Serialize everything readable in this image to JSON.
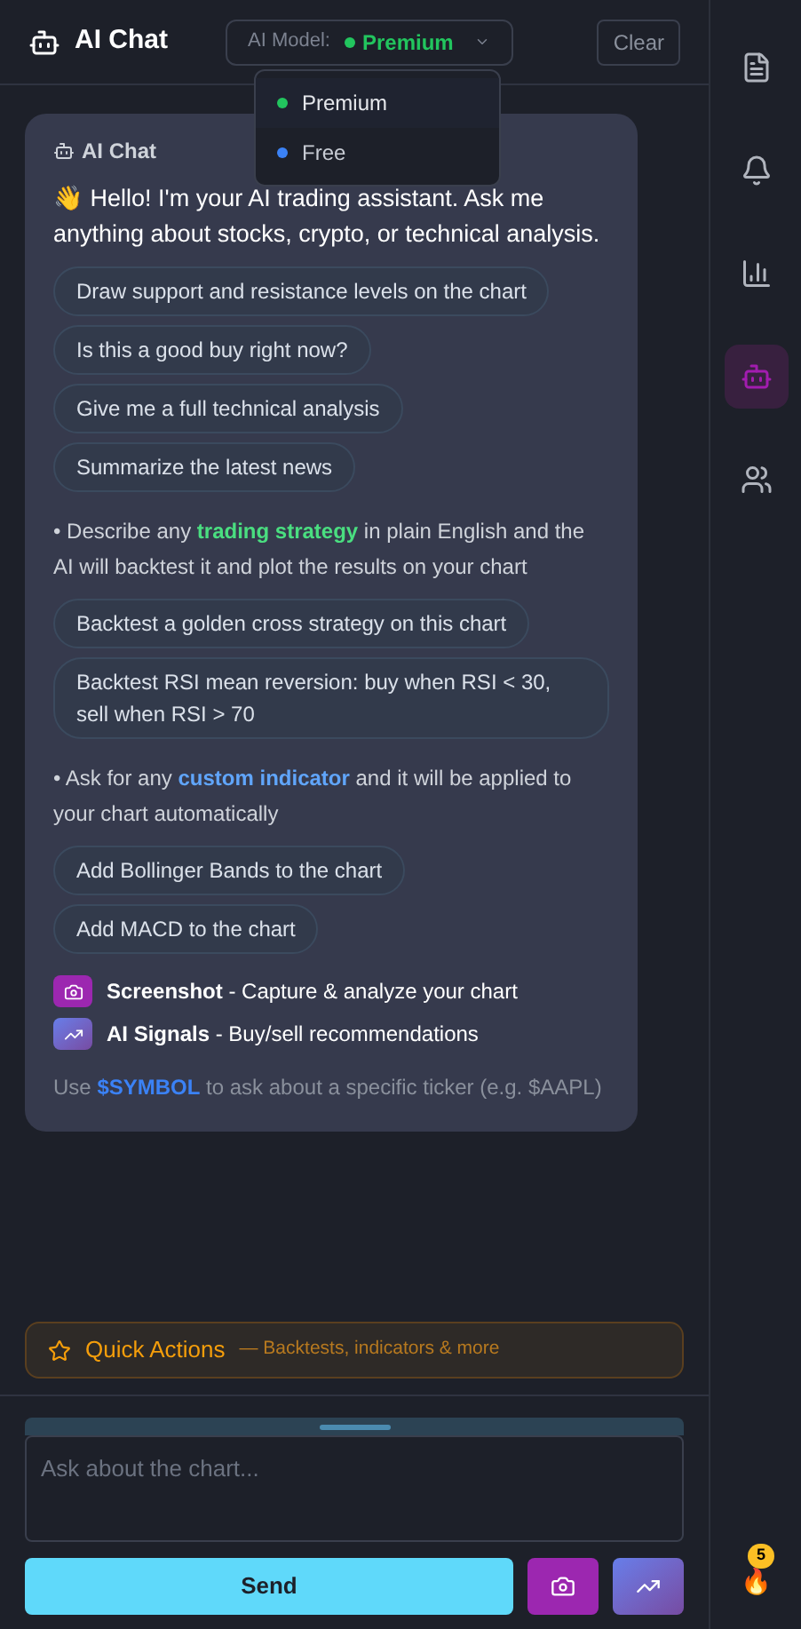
{
  "header": {
    "title": "AI Chat",
    "model": {
      "label": "AI Model:",
      "value": "Premium",
      "color": "#22c55e",
      "expanded": true,
      "options": [
        {
          "label": "Premium",
          "color": "#22c55e",
          "selected": true
        },
        {
          "label": "Free",
          "color": "#3b82f6",
          "selected": false
        }
      ]
    },
    "clear": "Clear"
  },
  "message": {
    "sender": "AI Chat",
    "greeting": "👋 Hello! I'm your AI trading assistant. Ask me anything about stocks, crypto, or technical analysis.",
    "suggestions": [
      "Draw support and resistance levels on the chart",
      "Is this a good buy right now?",
      "Give me a full technical analysis",
      "Summarize the latest news"
    ],
    "sections": [
      {
        "before": "• Describe any ",
        "highlight": "trading strategy",
        "after": " in plain English and the AI will backtest it and plot the results on your chart",
        "color": "#4ade80",
        "suggestions": [
          "Backtest a golden cross strategy on this chart",
          "Backtest RSI mean reversion: buy when RSI < 30, sell when RSI > 70"
        ]
      },
      {
        "before": "• Ask for any ",
        "highlight": "custom indicator",
        "after": " and it will be applied to your chart automatically",
        "color": "#60a5fa",
        "suggestions": [
          "Add Bollinger Bands to the chart",
          "Add MACD to the chart"
        ]
      }
    ],
    "features": [
      {
        "kind": "screenshot",
        "title": "Screenshot",
        "description": " - Capture & analyze your chart"
      },
      {
        "kind": "signals",
        "title": "AI Signals",
        "description": " - Buy/sell recommendations"
      }
    ],
    "tip": {
      "before": "Use ",
      "symbol": "$SYMBOL",
      "after": " to ask about a specific ticker (e.g. $AAPL)"
    }
  },
  "quick_actions": {
    "title": "Quick Actions",
    "subtitle": "— Backtests, indicators & more"
  },
  "composer": {
    "placeholder": "Ask about the chart...",
    "send": "Send"
  },
  "sidebar": {
    "items": [
      {
        "kind": "document",
        "selected": false
      },
      {
        "kind": "bell",
        "selected": false
      },
      {
        "kind": "chart",
        "selected": false
      },
      {
        "kind": "robot",
        "selected": true
      },
      {
        "kind": "people",
        "selected": false
      }
    ],
    "streak": {
      "emoji": "🔥",
      "count": "5"
    }
  }
}
